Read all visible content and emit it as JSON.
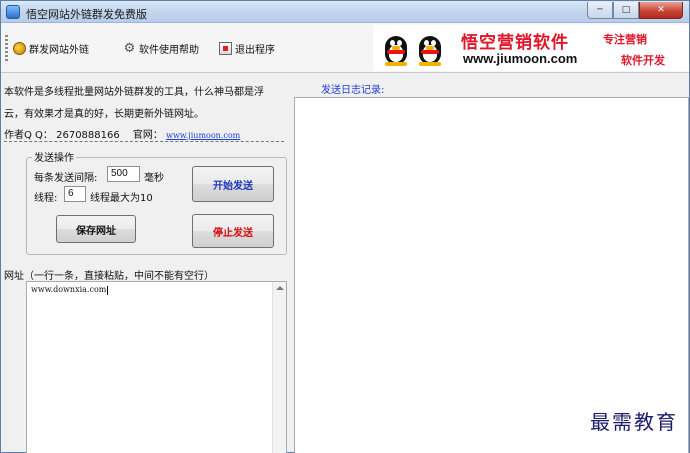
{
  "window": {
    "title": "悟空网站外链群发免费版",
    "controls": {
      "minimize": "─",
      "maximize": "□",
      "close": "✕"
    }
  },
  "toolbar": {
    "items": [
      {
        "label": "群发网站外链",
        "icon": "send-icon"
      },
      {
        "label": "软件使用帮助",
        "icon": "gear-icon"
      },
      {
        "label": "退出程序",
        "icon": "exit-icon"
      }
    ]
  },
  "banner": {
    "brand_cn": "悟空营销软件",
    "url": "www.jiumoon.com",
    "tag1": "专注营销",
    "tag2": "软件开发"
  },
  "intro": {
    "line1": "本软件是多线程批量网站外链群发的工具，什么神马都是浮",
    "line2": "云，有效果才是真的好，长期更新外链网址。",
    "author_label": "作者Q Q：",
    "author_qq": "2670888166",
    "site_label": "官网：",
    "site_url": "www.jiumoon.com"
  },
  "send_group": {
    "legend": "发送操作",
    "interval_label": "每条发送间隔:",
    "interval_value": "500",
    "interval_unit": "毫秒",
    "threads_label": "线程:",
    "threads_value": "6",
    "threads_hint": "线程最大为10",
    "start_button": "开始发送",
    "save_button": "保存网址",
    "stop_button": "停止发送"
  },
  "url_section": {
    "label": "网址（一行一条，直接粘贴，中间不能有空行）",
    "content": "www.downxia.com"
  },
  "log": {
    "label": "发送日志记录:"
  },
  "watermark": "最需教育"
}
